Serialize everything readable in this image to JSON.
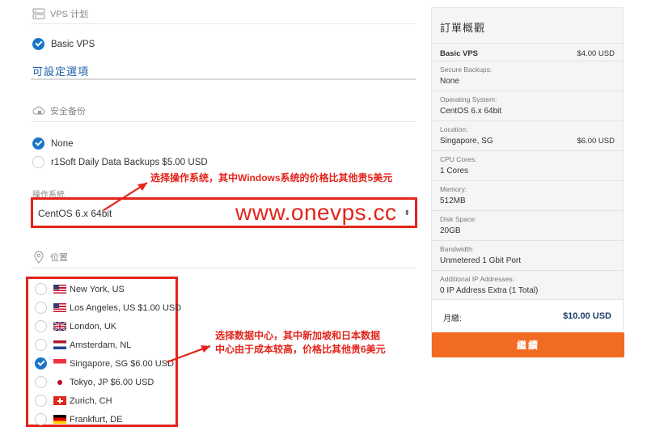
{
  "plan_section": {
    "heading": "VPS 计划",
    "product": "Basic VPS"
  },
  "config_title": "可設定選項",
  "backup_section": {
    "heading": "安全备份",
    "options": [
      {
        "label": "None",
        "selected": true
      },
      {
        "label": "r1Soft Daily Data Backups $5.00 USD",
        "selected": false
      }
    ]
  },
  "os_section": {
    "label": "操作系統",
    "value": "CentOS 6.x 64bit"
  },
  "location_section": {
    "heading": "位置",
    "options": [
      {
        "label": "New York, US",
        "flag": "us-flag",
        "selected": false
      },
      {
        "label": "Los Angeles, US $1.00 USD",
        "flag": "us-flag",
        "selected": false
      },
      {
        "label": "London, UK",
        "flag": "uk-flag",
        "selected": false
      },
      {
        "label": "Amsterdam, NL",
        "flag": "nl-flag",
        "selected": false
      },
      {
        "label": "Singapore, SG $6.00 USD",
        "flag": "sg-flag",
        "selected": true
      },
      {
        "label": "Tokyo, JP $6.00 USD",
        "flag": "jp-flag",
        "selected": false
      },
      {
        "label": "Zurich, CH",
        "flag": "ch-flag",
        "selected": false
      },
      {
        "label": "Frankfurt, DE",
        "flag": "de-flag",
        "selected": false
      }
    ]
  },
  "annotations": {
    "os_note": "选择操作系统，其中Windows系统的价格比其他贵5美元",
    "watermark": "www.onevps.cc",
    "location_note_line1": "选择数据中心，其中新加坡和日本数据",
    "location_note_line2": "中心由于成本较高，价格比其他贵6美元"
  },
  "summary": {
    "title": "訂單概觀",
    "product": "Basic VPS",
    "product_price": "$4.00 USD",
    "rows": [
      {
        "label": "Secure Backups:",
        "value": "None",
        "price": ""
      },
      {
        "label": "Operating System:",
        "value": "CentOS 6.x 64bit",
        "price": ""
      },
      {
        "label": "Location:",
        "value": "Singapore, SG",
        "price": "$6.00 USD"
      },
      {
        "label": "CPU Cores:",
        "value": "1 Cores",
        "price": ""
      },
      {
        "label": "Memory:",
        "value": "512MB",
        "price": ""
      },
      {
        "label": "Disk Space:",
        "value": "20GB",
        "price": ""
      },
      {
        "label": "Bandwidth:",
        "value": "Unmetered 1 Gbit Port",
        "price": ""
      },
      {
        "label": "Additional IP Addresses:",
        "value": "0 IP Address Extra (1 Total)",
        "price": ""
      }
    ],
    "total_label": "月繳:",
    "total_value": "$10.00 USD",
    "continue_label": "繼續"
  },
  "colors": {
    "accent": "#1a75c9",
    "annotation_red": "#e3241b",
    "continue_orange": "#f26b22"
  }
}
